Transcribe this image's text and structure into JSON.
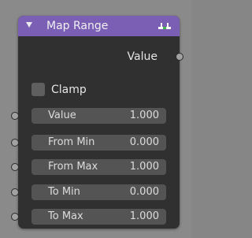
{
  "node": {
    "title": "Map Range",
    "output_label": "Value",
    "header_color": "#7b5fb4",
    "socket_color": "#a1a1a1",
    "clamp": {
      "label": "Clamp",
      "checked": false
    },
    "inputs": [
      {
        "label": "Value",
        "value": "1.000"
      },
      {
        "label": "From Min",
        "value": "0.000"
      },
      {
        "label": "From Max",
        "value": "1.000"
      },
      {
        "label": "To Min",
        "value": "0.000"
      },
      {
        "label": "To Max",
        "value": "1.000"
      }
    ]
  }
}
